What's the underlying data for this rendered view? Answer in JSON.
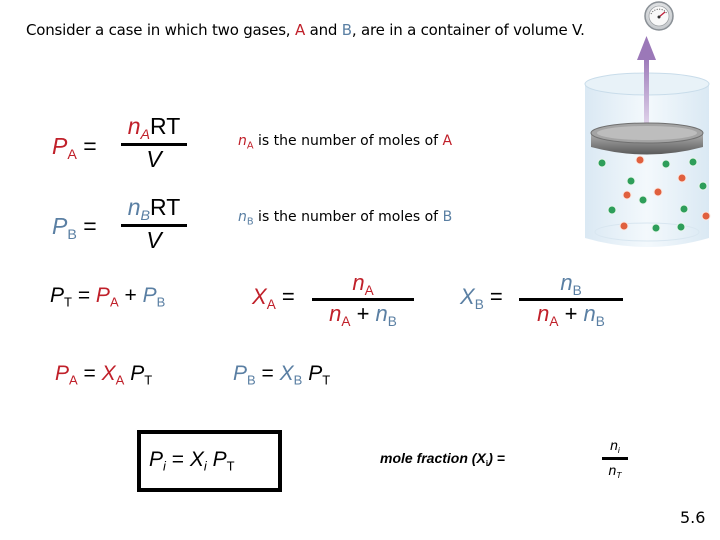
{
  "intro": {
    "before": "Consider a case in which two gases, ",
    "gas_a": "A",
    "middle": " and ",
    "gas_b": "B",
    "after": ", are in a container of volume V."
  },
  "equations": {
    "pa_ideal": {
      "lhs_var": "P",
      "lhs_sub": "A",
      "eq": "=",
      "num_var": "n",
      "num_sub": "A",
      "num_rest": "RT",
      "den": "V"
    },
    "pb_ideal": {
      "lhs_var": "P",
      "lhs_sub": "B",
      "eq": "=",
      "num_var": "n",
      "num_sub": "B",
      "num_rest": "RT",
      "den": "V"
    },
    "pt_sum": {
      "p": "P",
      "t": "T",
      "eq": "=",
      "a": "A",
      "plus": "+",
      "b": "B"
    },
    "xa_def": {
      "x": "X",
      "sub": "A",
      "eq": "=",
      "num_n": "n",
      "num_sub": "A",
      "den_n1": "n",
      "den_sub1": "A",
      "plus": "+",
      "den_n2": "n",
      "den_sub2": "B"
    },
    "xb_def": {
      "x": "X",
      "sub": "B",
      "eq": "=",
      "num_n": "n",
      "num_sub": "B",
      "den_n1": "n",
      "den_sub1": "A",
      "plus": "+",
      "den_n2": "n",
      "den_sub2": "B"
    },
    "pa_frac": {
      "p": "P",
      "sub": "A",
      "eq": "=",
      "x": "X",
      "xsub": "A",
      "pt": "P",
      "ptsub": "T"
    },
    "pb_frac": {
      "p": "P",
      "sub": "B",
      "eq": "=",
      "x": "X",
      "xsub": "B",
      "pt": "P",
      "ptsub": "T"
    },
    "general": {
      "p": "P",
      "psub": "i",
      "eq": "=",
      "x": "X",
      "xsub": "i",
      "pt": "P",
      "ptsub": "T"
    }
  },
  "notes": {
    "na": {
      "n": "n",
      "sub": "A",
      "text": " is the number of moles of ",
      "gas": "A"
    },
    "nb": {
      "n": "n",
      "sub": "B",
      "text": " is the number of moles of ",
      "gas": "B"
    }
  },
  "mole_fraction": {
    "label_before": "mole fraction (X",
    "label_sub": "i",
    "label_after": ") =",
    "num_n": "n",
    "num_sub": "i",
    "den_n": "n",
    "den_sub": "T"
  },
  "slide_number": "5.6",
  "colors": {
    "gas_a": "#c0202a",
    "gas_b": "#5a7fa3",
    "molecule_green": "#2e9e5a",
    "molecule_red": "#e0603e",
    "arrow": "#a88ac0"
  }
}
